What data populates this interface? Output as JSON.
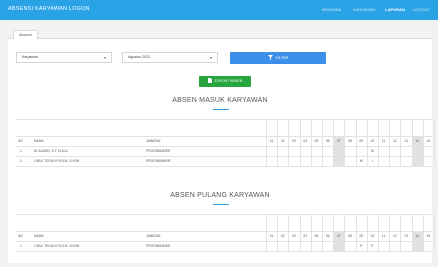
{
  "navbar": {
    "brand": "ABSENSI KARYAWAN LOGON",
    "items": [
      {
        "label": "BERANDA",
        "active": false
      },
      {
        "label": "KARYAWAN",
        "active": false
      },
      {
        "label": "LAPORAN",
        "active": true
      },
      {
        "label": "LOGOUT",
        "active": false
      }
    ]
  },
  "tabs": [
    {
      "label": "Absensi"
    }
  ],
  "filters": {
    "employee_select": "Karyawan",
    "period_select": "Agustus 2022",
    "filter_button": "FILTER",
    "export_button": "EXPORT ABSEN"
  },
  "sections": {
    "masuk": {
      "title": "ABSEN MASUK KARYAWAN",
      "headers": {
        "no": "NO",
        "name": "NAMA",
        "position": "JABATAN"
      },
      "days": [
        "01",
        "02",
        "03",
        "04",
        "05",
        "06",
        "07",
        "08",
        "09",
        "10",
        "11",
        "12",
        "13",
        "14",
        "15"
      ],
      "shaded_days": [
        7,
        14
      ],
      "rows": [
        {
          "no": "1",
          "name": "M. ALMAN, S.T, M.M.A",
          "position": "PROGRAMMER",
          "marks": {
            "10": "M"
          }
        },
        {
          "no": "2",
          "name": "LIRUL TEGUH PUJI M. CHOM",
          "position": "PROGRAMMER",
          "marks": {
            "9": "M",
            "10": "I"
          }
        }
      ]
    },
    "pulang": {
      "title": "ABSEN PULANG KARYAWAN",
      "headers": {
        "no": "NO",
        "name": "NAMA",
        "position": "JABATAN"
      },
      "days": [
        "01",
        "02",
        "03",
        "04",
        "05",
        "06",
        "07",
        "08",
        "09",
        "10",
        "11",
        "12",
        "13",
        "14",
        "15"
      ],
      "shaded_days": [
        7,
        14
      ],
      "rows": [
        {
          "no": "1",
          "name": "LIRUL TEGUH PUJI M. CHOM",
          "position": "PROGRAMMER",
          "marks": {
            "9": "P",
            "10": "P"
          }
        }
      ]
    }
  },
  "colors": {
    "navbar": "#2aa3e6",
    "filter_button": "#3b8eea",
    "export_button": "#27a53f",
    "weekend_shade": "#e1e1e1"
  }
}
